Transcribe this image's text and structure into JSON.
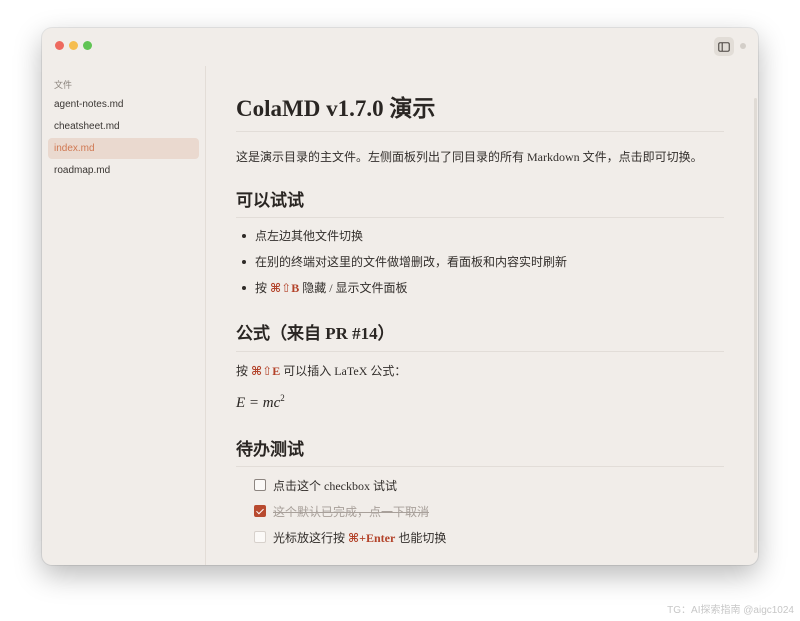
{
  "sidebar": {
    "title": "文件",
    "files": [
      {
        "label": "agent-notes.md"
      },
      {
        "label": "cheatsheet.md"
      },
      {
        "label": "index.md"
      },
      {
        "label": "roadmap.md"
      }
    ],
    "active_index": 2
  },
  "toolbar": {
    "toggle_icon": "sidebar-toggle-icon"
  },
  "document": {
    "title": "ColaMD v1.7.0 演示",
    "intro": "这是演示目录的主文件。左侧面板列出了同目录的所有 Markdown 文件，点击即可切换。",
    "section1": {
      "heading": "可以试试",
      "bullets": [
        {
          "text": "点左边其他文件切换"
        },
        {
          "text": "在别的终端对这里的文件做增删改，看面板和内容实时刷新"
        },
        {
          "prefix": "按 ",
          "kbd": "⌘⇧B",
          "suffix": " 隐藏 / 显示文件面板"
        }
      ]
    },
    "section2": {
      "heading": "公式（来自 PR #14）",
      "line_prefix": "按 ",
      "line_kbd": "⌘⇧E",
      "line_suffix": " 可以插入 LaTeX 公式：",
      "formula": "E = mc",
      "formula_exp": "2"
    },
    "section3": {
      "heading": "待办测试",
      "tasks": [
        {
          "text": "点击这个 checkbox 试试",
          "checked": false
        },
        {
          "text": "这个默认已完成，点一下取消",
          "checked": true
        },
        {
          "prefix": "光标放这行按 ",
          "kbd": "⌘+Enter",
          "suffix": " 也能切换",
          "checked": false
        }
      ]
    }
  },
  "watermark": "TG：AI探索指南 @aigc1024",
  "colors": {
    "accent": "#b3432a",
    "active_file": "#d07852",
    "active_bg": "#ead9cf",
    "window_bg": "#f1ede9"
  }
}
